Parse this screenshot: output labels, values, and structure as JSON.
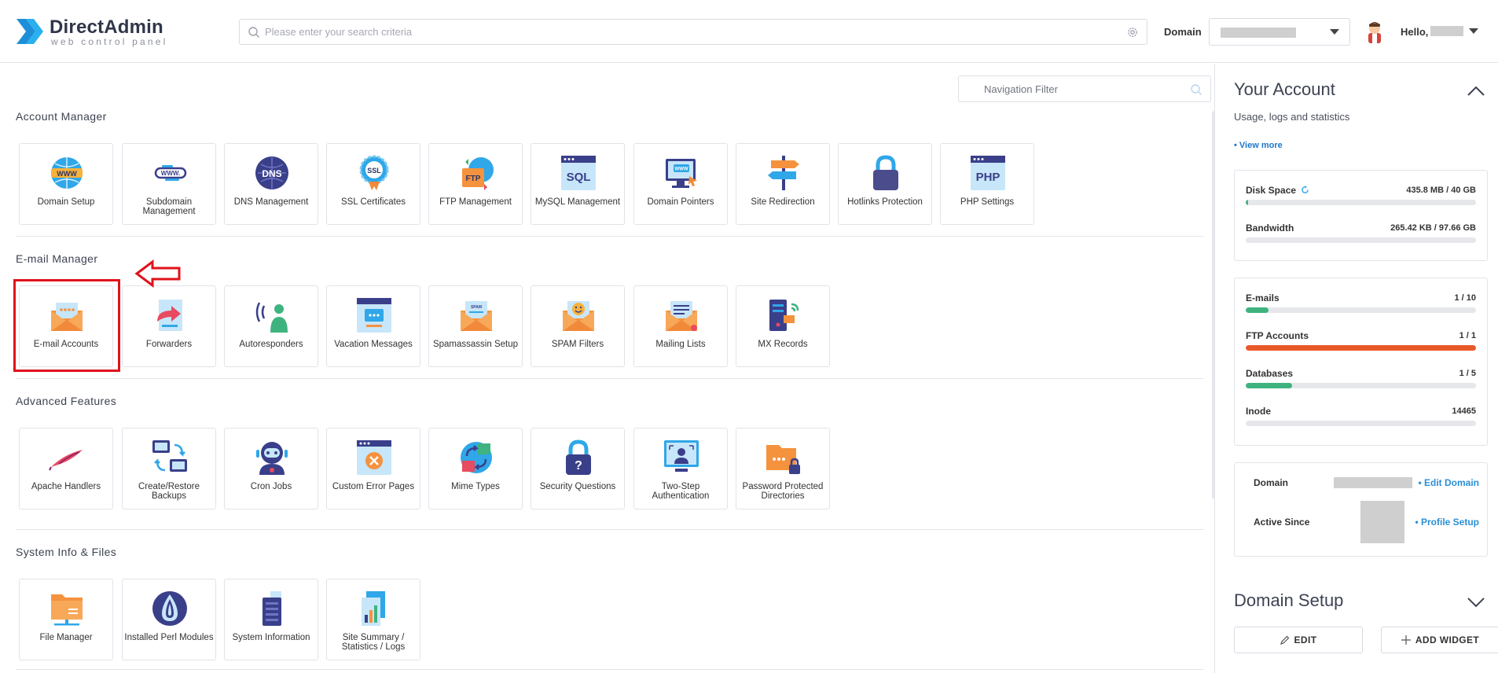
{
  "header": {
    "logo_name": "DirectAdmin",
    "logo_tagline": "web control panel",
    "search_placeholder": "Please enter your search criteria",
    "domain_label": "Domain",
    "greeting": "Hello,"
  },
  "navigation_filter_placeholder": "Navigation Filter",
  "sections": {
    "account_manager": {
      "title": "Account Manager",
      "items": [
        {
          "label": "Domain Setup",
          "icon": "globe-www-icon"
        },
        {
          "label": "Subdomain Management",
          "icon": "subdomain-icon"
        },
        {
          "label": "DNS Management",
          "icon": "dns-globe-icon"
        },
        {
          "label": "SSL Certificates",
          "icon": "ssl-badge-icon"
        },
        {
          "label": "FTP Management",
          "icon": "ftp-folder-icon"
        },
        {
          "label": "MySQL Management",
          "icon": "sql-database-icon"
        },
        {
          "label": "Domain Pointers",
          "icon": "domain-pointer-icon"
        },
        {
          "label": "Site Redirection",
          "icon": "signpost-icon"
        },
        {
          "label": "Hotlinks Protection",
          "icon": "padlock-icon"
        },
        {
          "label": "PHP Settings",
          "icon": "php-window-icon"
        }
      ]
    },
    "email_manager": {
      "title": "E-mail Manager",
      "items": [
        {
          "label": "E-mail Accounts",
          "icon": "envelope-icon"
        },
        {
          "label": "Forwarders",
          "icon": "forward-document-icon"
        },
        {
          "label": "Autoresponders",
          "icon": "autoresponder-person-icon"
        },
        {
          "label": "Vacation Messages",
          "icon": "vacation-message-icon"
        },
        {
          "label": "Spamassassin Setup",
          "icon": "spam-envelope-icon"
        },
        {
          "label": "SPAM Filters",
          "icon": "smiley-envelope-icon"
        },
        {
          "label": "Mailing Lists",
          "icon": "mailing-list-envelope-icon"
        },
        {
          "label": "MX Records",
          "icon": "mx-server-icon"
        }
      ]
    },
    "advanced_features": {
      "title": "Advanced Features",
      "items": [
        {
          "label": "Apache Handlers",
          "icon": "apache-feather-icon"
        },
        {
          "label": "Create/Restore Backups",
          "icon": "backup-monitors-icon"
        },
        {
          "label": "Cron Jobs",
          "icon": "robot-icon"
        },
        {
          "label": "Custom Error Pages",
          "icon": "error-page-icon"
        },
        {
          "label": "Mime Types",
          "icon": "mime-globe-icon"
        },
        {
          "label": "Security Questions",
          "icon": "question-lock-icon"
        },
        {
          "label": "Two-Step Authentication",
          "icon": "two-step-monitor-icon"
        },
        {
          "label": "Password Protected Directories",
          "icon": "locked-folder-icon"
        }
      ]
    },
    "system_info": {
      "title": "System Info & Files",
      "items": [
        {
          "label": "File Manager",
          "icon": "file-folder-icon"
        },
        {
          "label": "Installed Perl Modules",
          "icon": "perl-onion-icon"
        },
        {
          "label": "System Information",
          "icon": "server-tower-icon"
        },
        {
          "label": "Site Summary / Statistics / Logs",
          "icon": "statistics-icon"
        }
      ]
    }
  },
  "sidebar": {
    "title": "Your Account",
    "subtitle": "Usage, logs and statistics",
    "view_more": "• View more",
    "usage": [
      {
        "label": "Disk Space",
        "value": "435.8 MB / 40 GB",
        "fill_fraction": 0.011,
        "color": "#3fb37f"
      },
      {
        "label": "Bandwidth",
        "value": "265.42 KB / 97.66 GB",
        "fill_fraction": 0.0,
        "color": "#3fb37f"
      }
    ],
    "limits": [
      {
        "label": "E-mails",
        "value": "1 / 10",
        "fill_fraction": 0.1,
        "color": "#3fb37f"
      },
      {
        "label": "FTP Accounts",
        "value": "1 / 1",
        "fill_fraction": 1.0,
        "color": "#e8592a"
      },
      {
        "label": "Databases",
        "value": "1 / 5",
        "fill_fraction": 0.2,
        "color": "#3fb37f"
      },
      {
        "label": "Inode",
        "value": "14465",
        "fill_fraction": 0.0,
        "color": "#3fb37f"
      }
    ],
    "domain_label": "Domain",
    "edit_domain": "• Edit Domain",
    "active_since_label": "Active Since",
    "profile_setup": "• Profile Setup",
    "domain_setup_title": "Domain Setup",
    "edit_button": "EDIT",
    "add_widget_button": "ADD WIDGET"
  }
}
